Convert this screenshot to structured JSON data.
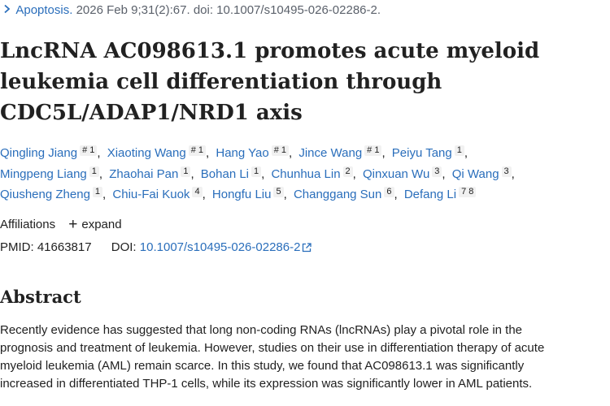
{
  "citation": {
    "journal": "Apoptosis.",
    "details": "2026 Feb 9;31(2):67. doi: 10.1007/s10495-026-02286-2."
  },
  "title_lines": [
    "LncRNA AC098613.1 promotes acute myeloid",
    "leukemia cell differentiation through",
    "CDC5L/ADAP1/NRD1 axis"
  ],
  "author_lines": [
    [
      {
        "name": "Qingling Jiang",
        "sup": "# 1"
      },
      {
        "name": "Xiaoting Wang",
        "sup": "# 1"
      },
      {
        "name": "Hang Yao",
        "sup": "# 1"
      },
      {
        "name": "Jince Wang",
        "sup": "# 1"
      },
      {
        "name": "Peiyu Tang",
        "sup": "1"
      }
    ],
    [
      {
        "name": "Mingpeng Liang",
        "sup": "1"
      },
      {
        "name": "Zhaohai Pan",
        "sup": "1"
      },
      {
        "name": "Bohan Li",
        "sup": "1"
      },
      {
        "name": "Chunhua Lin",
        "sup": "2"
      },
      {
        "name": "Qinxuan Wu",
        "sup": "3"
      },
      {
        "name": "Qi Wang",
        "sup": "3"
      }
    ],
    [
      {
        "name": "Qiusheng Zheng",
        "sup": "1"
      },
      {
        "name": "Chiu-Fai Kuok",
        "sup": "4"
      },
      {
        "name": "Hongfu Liu",
        "sup": "5"
      },
      {
        "name": "Changgang Sun",
        "sup": "6"
      },
      {
        "name": "Defang Li",
        "sup": "7 8"
      }
    ]
  ],
  "affiliations": {
    "label": "Affiliations",
    "expand": "expand"
  },
  "identifiers": {
    "pmid_label": "PMID:",
    "pmid": "41663817",
    "doi_label": "DOI:",
    "doi": "10.1007/s10495-026-02286-2"
  },
  "abstract": {
    "heading": "Abstract",
    "lines": [
      "Recently evidence has suggested that long non-coding RNAs (lncRNAs) play a pivotal role in the",
      "prognosis and treatment of leukemia. However, studies on their use in differentiation therapy of acute",
      "myeloid leukemia (AML) remain scarce. In this study, we found that AC098613.1 was significantly",
      "increased in differentiated THP-1 cells, while its expression was significantly lower in AML patients."
    ]
  },
  "icons": {
    "citation_chevron": "chevron-right-icon",
    "expand": "plus-icon",
    "doi_external": "external-link-icon"
  },
  "colors": {
    "link": "#2a6ebb",
    "text": "#212121",
    "muted": "#5b616b",
    "sup_bg": "#f1f1f1"
  }
}
